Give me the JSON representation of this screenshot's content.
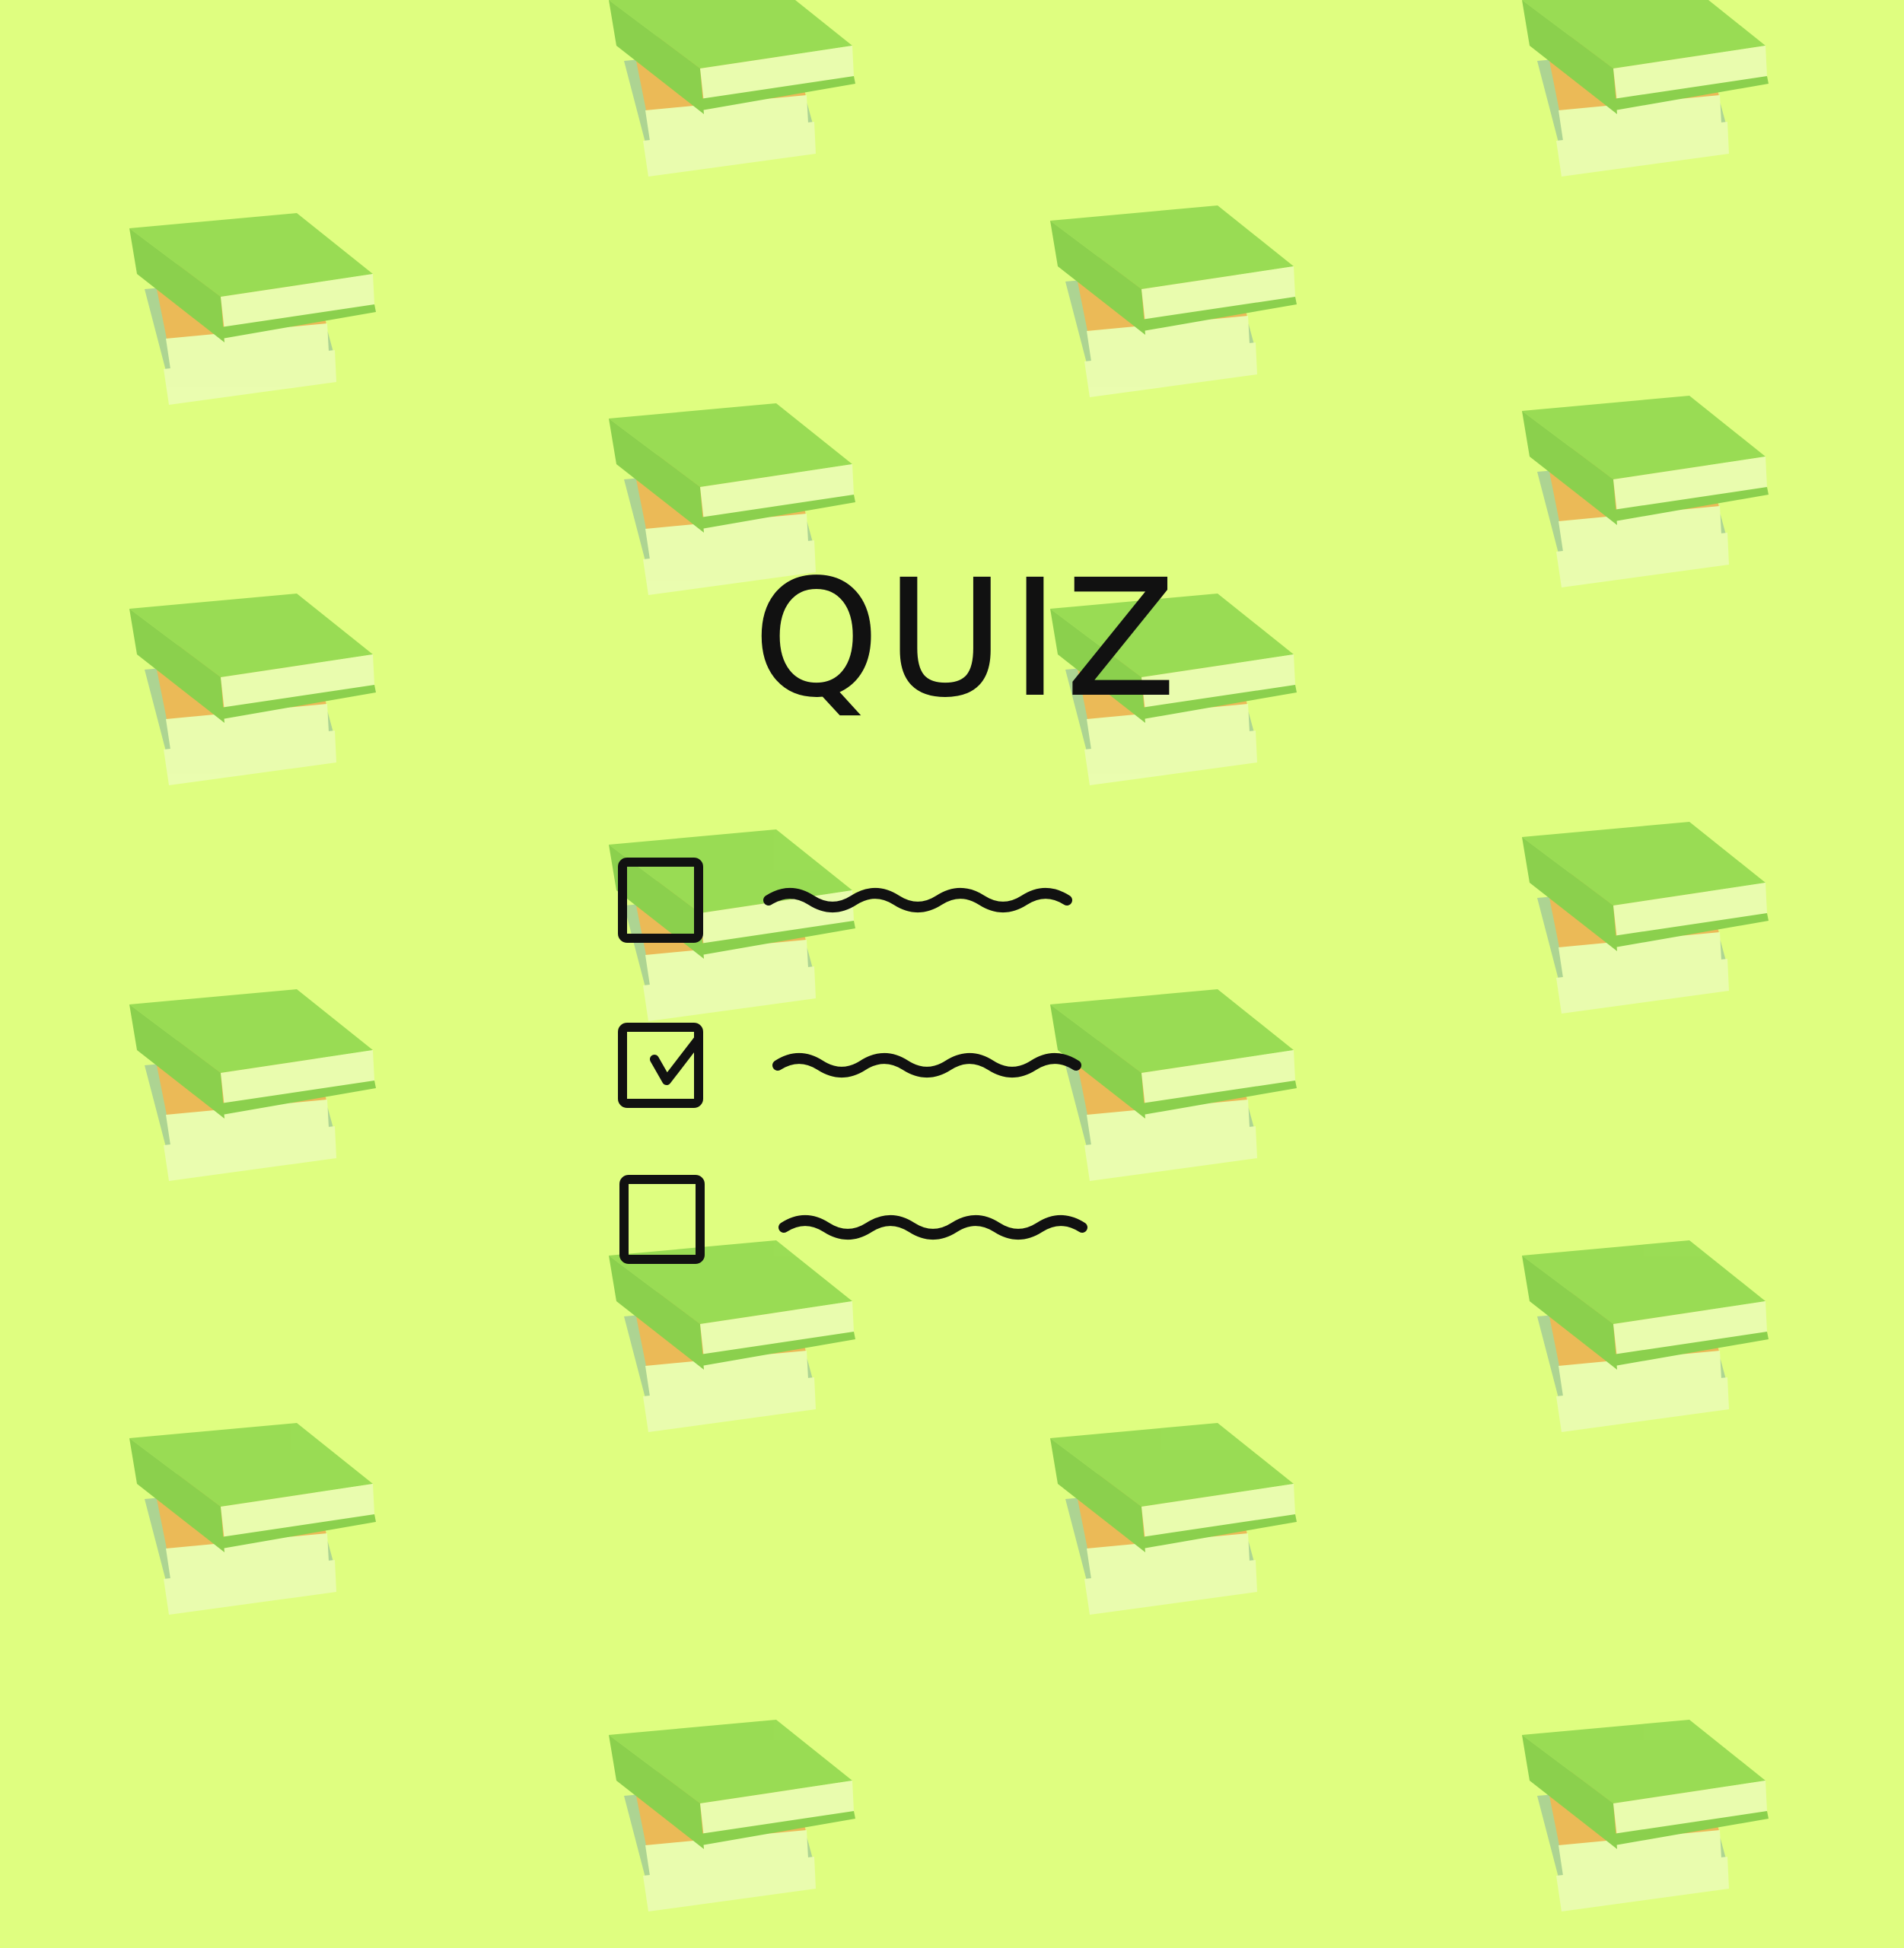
{
  "background_color": "#dffe80",
  "title": "QUIZ",
  "checklist": [
    {
      "checked": false
    },
    {
      "checked": true
    },
    {
      "checked": false
    }
  ],
  "icons": {
    "book_stack": "book-stack-icon",
    "checkbox": "checkbox-icon",
    "checkmark": "checkmark-icon",
    "squiggle": "squiggle-line"
  },
  "colors": {
    "ink": "#111111",
    "book_green": "#7fd044",
    "book_orange": "#f0a048",
    "book_page": "#eefcc0",
    "book_teal": "#9bc49a"
  }
}
